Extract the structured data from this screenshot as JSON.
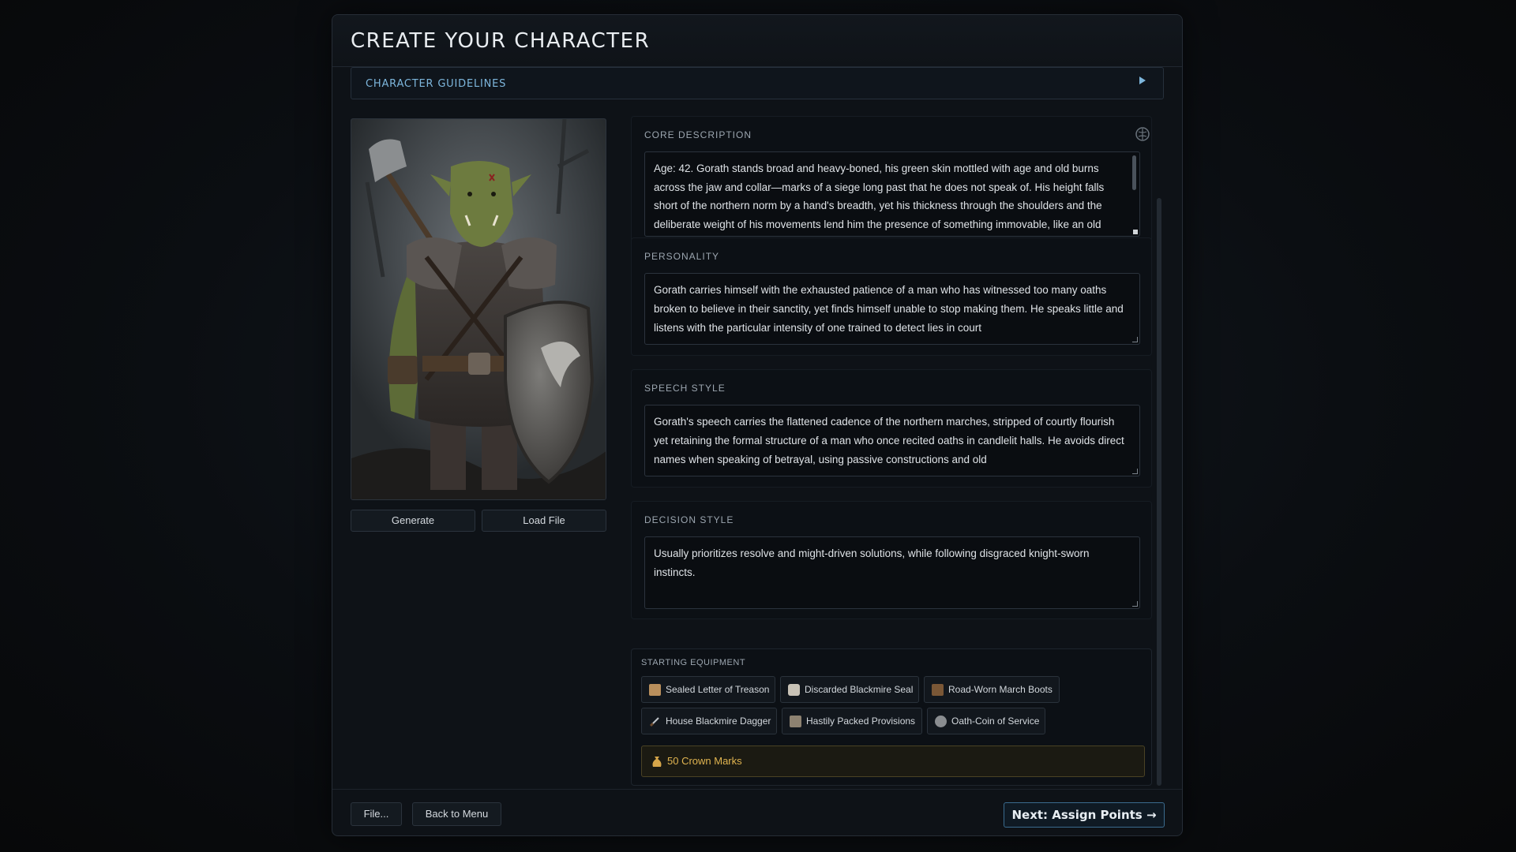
{
  "header": {
    "title": "CREATE YOUR CHARACTER"
  },
  "guidelines": {
    "label": "CHARACTER GUIDELINES"
  },
  "portrait": {
    "generate_label": "Generate",
    "load_label": "Load File"
  },
  "core": {
    "label": "CORE DESCRIPTION",
    "text": "Age: 42. Gorath stands broad and heavy-boned, his green skin mottled with age and old burns across the jaw and collar—marks of a siege long past that he does not speak of. His height falls short of the northern norm by a hand's breadth, yet his thickness through the shoulders and the deliberate weight of his movements lend him the presence of something immovable, like an old"
  },
  "personality": {
    "label": "PERSONALITY",
    "text": "Gorath carries himself with the exhausted patience of a man who has witnessed too many oaths broken to believe in their sanctity, yet finds himself unable to stop making them. He speaks little and listens with the particular intensity of one trained to detect lies in court"
  },
  "speech": {
    "label": "SPEECH STYLE",
    "text": "Gorath's speech carries the flattened cadence of the northern marches, stripped of courtly flourish yet retaining the formal structure of a man who once recited oaths in candlelit halls. He avoids direct names when speaking of betrayal, using passive constructions and old"
  },
  "decision": {
    "label": "DECISION STYLE",
    "text": "Usually prioritizes resolve and might-driven solutions, while following disgraced knight-sworn instincts."
  },
  "equipment": {
    "label": "STARTING EQUIPMENT",
    "items": [
      {
        "label": "Sealed Letter of Treason",
        "icon": "letter-icon"
      },
      {
        "label": "Discarded Blackmire Seal",
        "icon": "seal-icon"
      },
      {
        "label": "Road-Worn March Boots",
        "icon": "boots-icon"
      },
      {
        "label": "House Blackmire Dagger",
        "icon": "dagger-icon"
      },
      {
        "label": "Hastily Packed Provisions",
        "icon": "provisions-icon"
      },
      {
        "label": "Oath-Coin of Service",
        "icon": "coin-icon"
      }
    ],
    "currency": "50 Crown Marks"
  },
  "footer": {
    "file_label": "File...",
    "back_label": "Back to Menu",
    "next_label": "Next: Assign Points →"
  },
  "colors": {
    "accent": "#7db6dc",
    "gold": "#e0b450",
    "panel": "#0e1217"
  }
}
